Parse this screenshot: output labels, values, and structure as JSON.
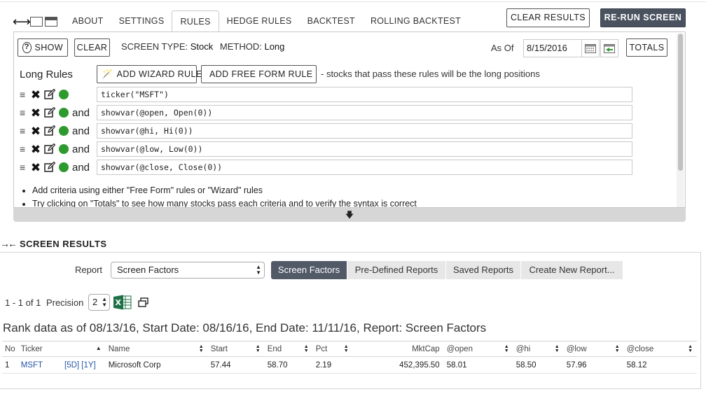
{
  "window": {
    "expand_icon": "expand-arrows-icon",
    "restore_icon": "window-icon",
    "minimize_icon": "minimized-window-icon"
  },
  "tabs": [
    {
      "label": "ABOUT"
    },
    {
      "label": "SETTINGS"
    },
    {
      "label": "RULES",
      "active": true
    },
    {
      "label": "HEDGE RULES"
    },
    {
      "label": "BACKTEST"
    },
    {
      "label": "ROLLING BACKTEST"
    }
  ],
  "toolbar": {
    "clear_results": "CLEAR RESULTS",
    "rerun": "RE-RUN SCREEN"
  },
  "rules_panel": {
    "show_label": "SHOW",
    "clear_label": "CLEAR",
    "screen_type_label": "SCREEN TYPE:",
    "screen_type_value": "Stock",
    "method_label": "METHOD:",
    "method_value": "Long",
    "as_of_label": "As Of",
    "as_of_value": "8/15/2016",
    "totals_label": "TOTALS",
    "long_rules_title": "Long Rules",
    "add_wizard": "ADD WIZARD RULE",
    "add_free_form": "ADD FREE FORM RULE",
    "description": "- stocks that pass these rules will be the long positions",
    "rules": [
      {
        "connector": "",
        "expression": "ticker(\"MSFT\")"
      },
      {
        "connector": "and",
        "expression": "showvar(@open, Open(0))"
      },
      {
        "connector": "and",
        "expression": "showvar(@hi, Hi(0))"
      },
      {
        "connector": "and",
        "expression": "showvar(@low, Low(0))"
      },
      {
        "connector": "and",
        "expression": "showvar(@close, Close(0))"
      }
    ],
    "tips": [
      "Add criteria using either \"Free Form\" rules or \"Wizard\" rules",
      "Try clicking on \"Totals\" to see how many stocks pass each criteria and to verify the syntax is correct"
    ],
    "collapse_arrow": "🡇"
  },
  "results": {
    "title": "SCREEN RESULTS",
    "report_label": "Report",
    "report_value": "Screen Factors",
    "report_tabs": [
      "Screen Factors",
      "Pre-Defined Reports",
      "Saved Reports",
      "Create New Report..."
    ],
    "paging": "1 - 1 of 1",
    "precision_label": "Precision",
    "precision_value": "2",
    "rank_line": "Rank data as of 08/13/16, Start Date: 08/16/16, End Date: 11/11/16, Report: Screen Factors",
    "columns": [
      "No",
      "Ticker",
      "Name",
      "Start",
      "End",
      "Pct",
      "MktCap",
      "@open",
      "@hi",
      "@low",
      "@close"
    ],
    "rows": [
      {
        "no": "1",
        "ticker": "MSFT",
        "periods": "[5D] [1Y]",
        "name": "Microsoft Corp",
        "start": "57.44",
        "end": "58.70",
        "pct": "2.19",
        "mktcap": "452,395.50",
        "open": "58.01",
        "hi": "58.50",
        "low": "57.96",
        "close": "58.12"
      }
    ]
  },
  "colors": {
    "accent_dark": "#4a5260",
    "active_tab": "#525a68",
    "status_green": "#2e9a2e",
    "link": "#2556a8"
  }
}
